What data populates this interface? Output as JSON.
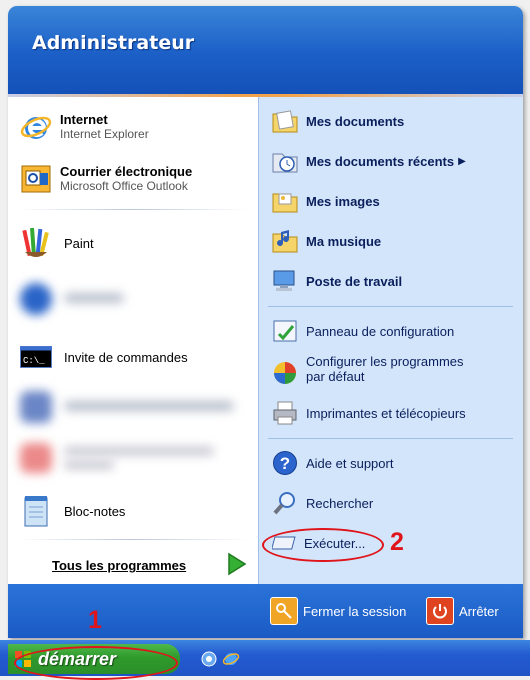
{
  "header": {
    "user_name": "Administrateur"
  },
  "pinned": [
    {
      "title": "Internet",
      "subtitle": "Internet Explorer",
      "icon": "ie-icon"
    },
    {
      "title": "Courrier électronique",
      "subtitle": "Microsoft Office Outlook",
      "icon": "outlook-icon"
    }
  ],
  "recent": [
    {
      "label": "Paint",
      "icon": "paint-icon"
    },
    {
      "label": "Invite de commandes",
      "icon": "cmd-icon"
    },
    {
      "label": "Bloc-notes",
      "icon": "notepad-icon"
    }
  ],
  "all_programs_label": "Tous les programmes",
  "right": {
    "mes_documents": "Mes documents",
    "mes_documents_recents": "Mes documents récents",
    "mes_images": "Mes images",
    "ma_musique": "Ma musique",
    "poste_de_travail": "Poste de travail",
    "panneau_config": "Panneau de configuration",
    "configurer_programmes_1": "Configurer les programmes",
    "configurer_programmes_2": "par défaut",
    "imprimantes": "Imprimantes et télécopieurs",
    "aide": "Aide et support",
    "rechercher": "Rechercher",
    "executer": "Exécuter..."
  },
  "footer": {
    "logoff": "Fermer la session",
    "shutdown": "Arrêter"
  },
  "taskbar": {
    "start_label": "démarrer"
  },
  "annotations": {
    "step1": "1",
    "step2": "2"
  },
  "colors": {
    "accent": "#1b5fc7",
    "annotation": "#e0141b",
    "start_green": "#2f9a2c"
  }
}
